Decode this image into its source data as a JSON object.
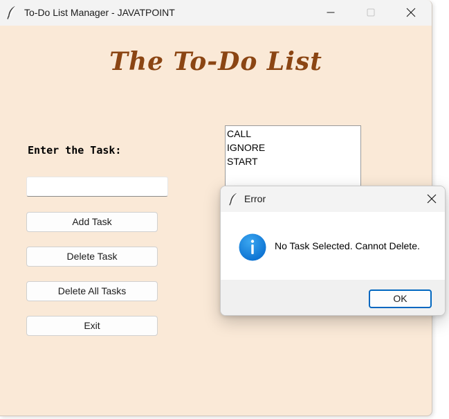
{
  "window": {
    "title": "To-Do List Manager - JAVATPOINT",
    "icon": "feather-icon"
  },
  "app": {
    "heading": "The To-Do List",
    "task_label": "Enter the Task:",
    "task_entry_value": "",
    "buttons": {
      "add": "Add Task",
      "delete": "Delete Task",
      "delete_all": "Delete All Tasks",
      "exit": "Exit"
    },
    "tasks": [
      "CALL",
      "IGNORE",
      "START"
    ]
  },
  "dialog": {
    "title": "Error",
    "icon": "info-icon",
    "message": "No Task Selected. Cannot Delete.",
    "ok_label": "OK"
  },
  "colors": {
    "background": "#fae9d7",
    "heading": "#8b4513",
    "info_blue": "#0a79d8",
    "ok_border": "#0067c0"
  }
}
